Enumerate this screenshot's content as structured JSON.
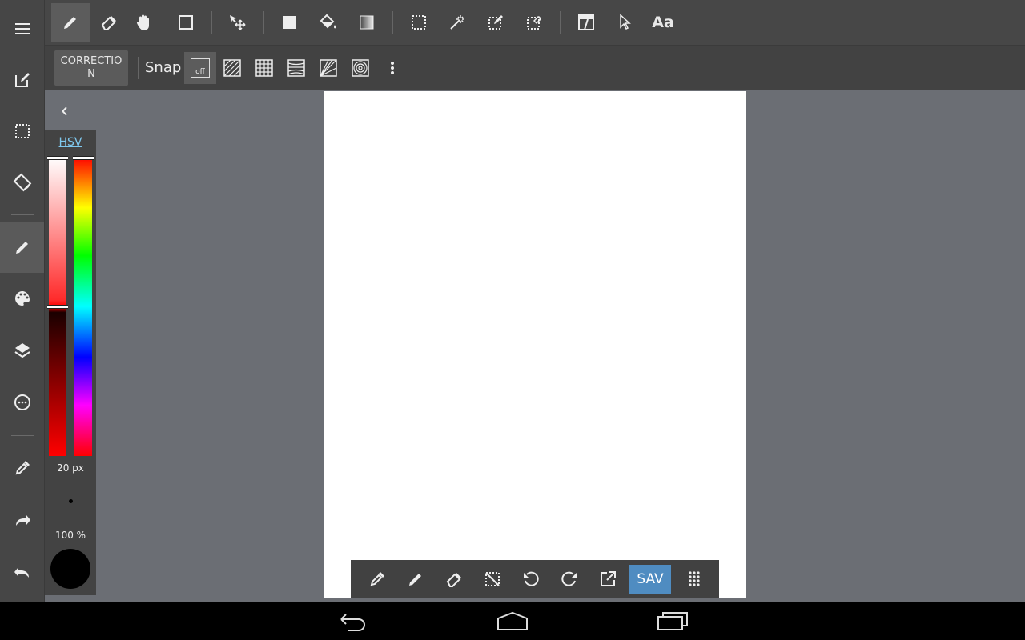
{
  "toolbar": {
    "text_tool_label": "Aa",
    "colors": {
      "background": "#474747",
      "active": "#5c5c5c"
    }
  },
  "subbar": {
    "correction_label": "CORRECTION",
    "snap_label": "Snap",
    "snap_off_label": "off"
  },
  "color_panel": {
    "mode_label": "HSV",
    "brush_size": "20 px",
    "opacity": "100 %",
    "current_color": "#000000"
  },
  "bottom_bar": {
    "save_label": "SAV",
    "save_color": "#4f8cc1"
  },
  "canvas": {
    "background": "#ffffff"
  },
  "icons": {
    "left": [
      "menu-icon",
      "edit-icon",
      "selection-icon",
      "rotate-icon",
      "pen-icon",
      "palette-icon",
      "layers-icon",
      "more-circle-icon",
      "eyedropper-icon",
      "redo-icon",
      "undo-icon"
    ],
    "top": [
      "pen-icon",
      "eraser-icon",
      "hand-icon",
      "rectangle-icon",
      "move-icon",
      "fill-rect-icon",
      "bucket-icon",
      "gradient-icon",
      "select-rect-icon",
      "magic-wand-icon",
      "select-pen-icon",
      "select-eraser-icon",
      "frame-icon",
      "pointer-icon"
    ],
    "snap": [
      "snap-off-icon",
      "parallel-snap-icon",
      "grid-snap-icon",
      "perspective-snap-icon",
      "diagonal-snap-icon",
      "circle-snap-icon",
      "more-vert-icon"
    ],
    "bottom": [
      "eyedropper-icon",
      "pen-icon",
      "eraser-icon",
      "deselect-icon",
      "undo-icon",
      "redo-icon",
      "share-icon",
      "grid-menu-icon"
    ],
    "nav": [
      "back-icon",
      "home-icon",
      "recents-icon"
    ]
  }
}
